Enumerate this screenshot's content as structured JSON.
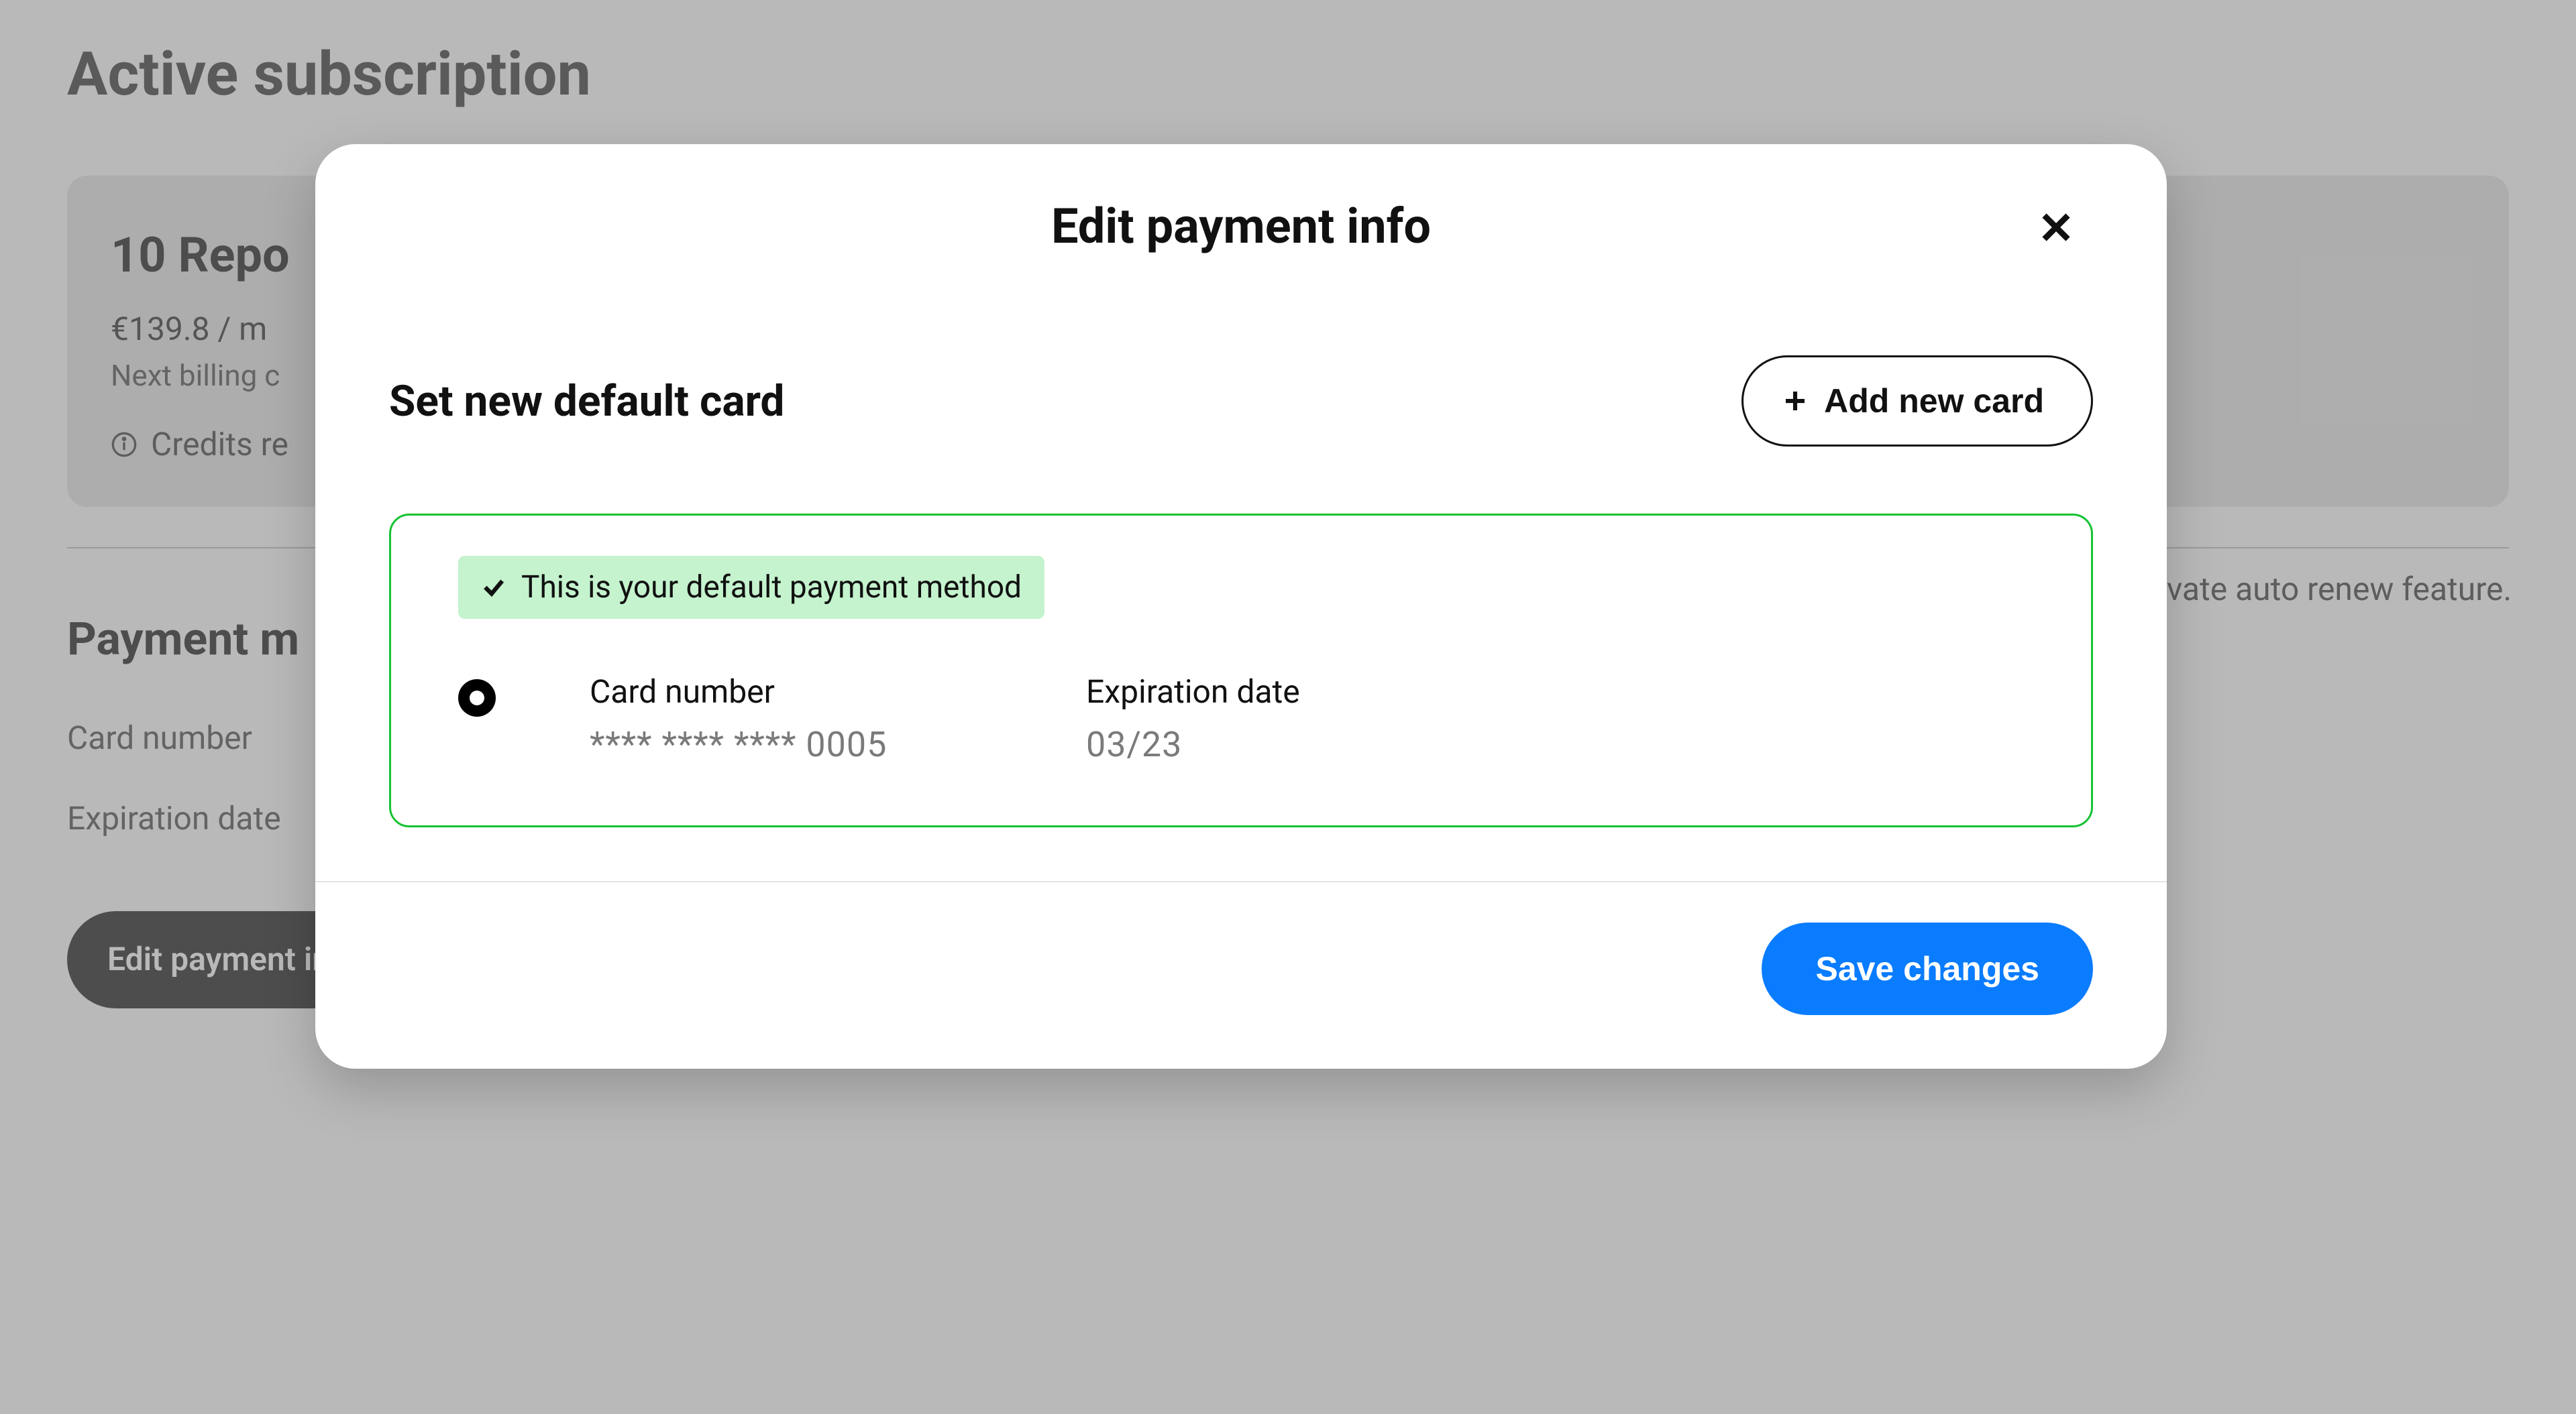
{
  "page": {
    "title": "Active subscription",
    "plan_name": "10 Repo",
    "price_line": "€139.8 / m",
    "next_billing": "Next billing c",
    "credits_note": "Credits re",
    "auto_renew_tail": "vate auto renew feature.",
    "section_payment": "Payment m",
    "field_card_number": "Card number",
    "field_expiration": "Expiration date",
    "edit_button_label": "Edit payment info"
  },
  "modal": {
    "title": "Edit payment info",
    "subtitle": "Set new default card",
    "add_card_label": "Add new card",
    "default_badge_text": "This is your default payment method",
    "columns": {
      "card_number_label": "Card number",
      "card_number_value": "**** **** **** 0005",
      "expiration_label": "Expiration date",
      "expiration_value": "03/23"
    },
    "save_label": "Save changes"
  }
}
